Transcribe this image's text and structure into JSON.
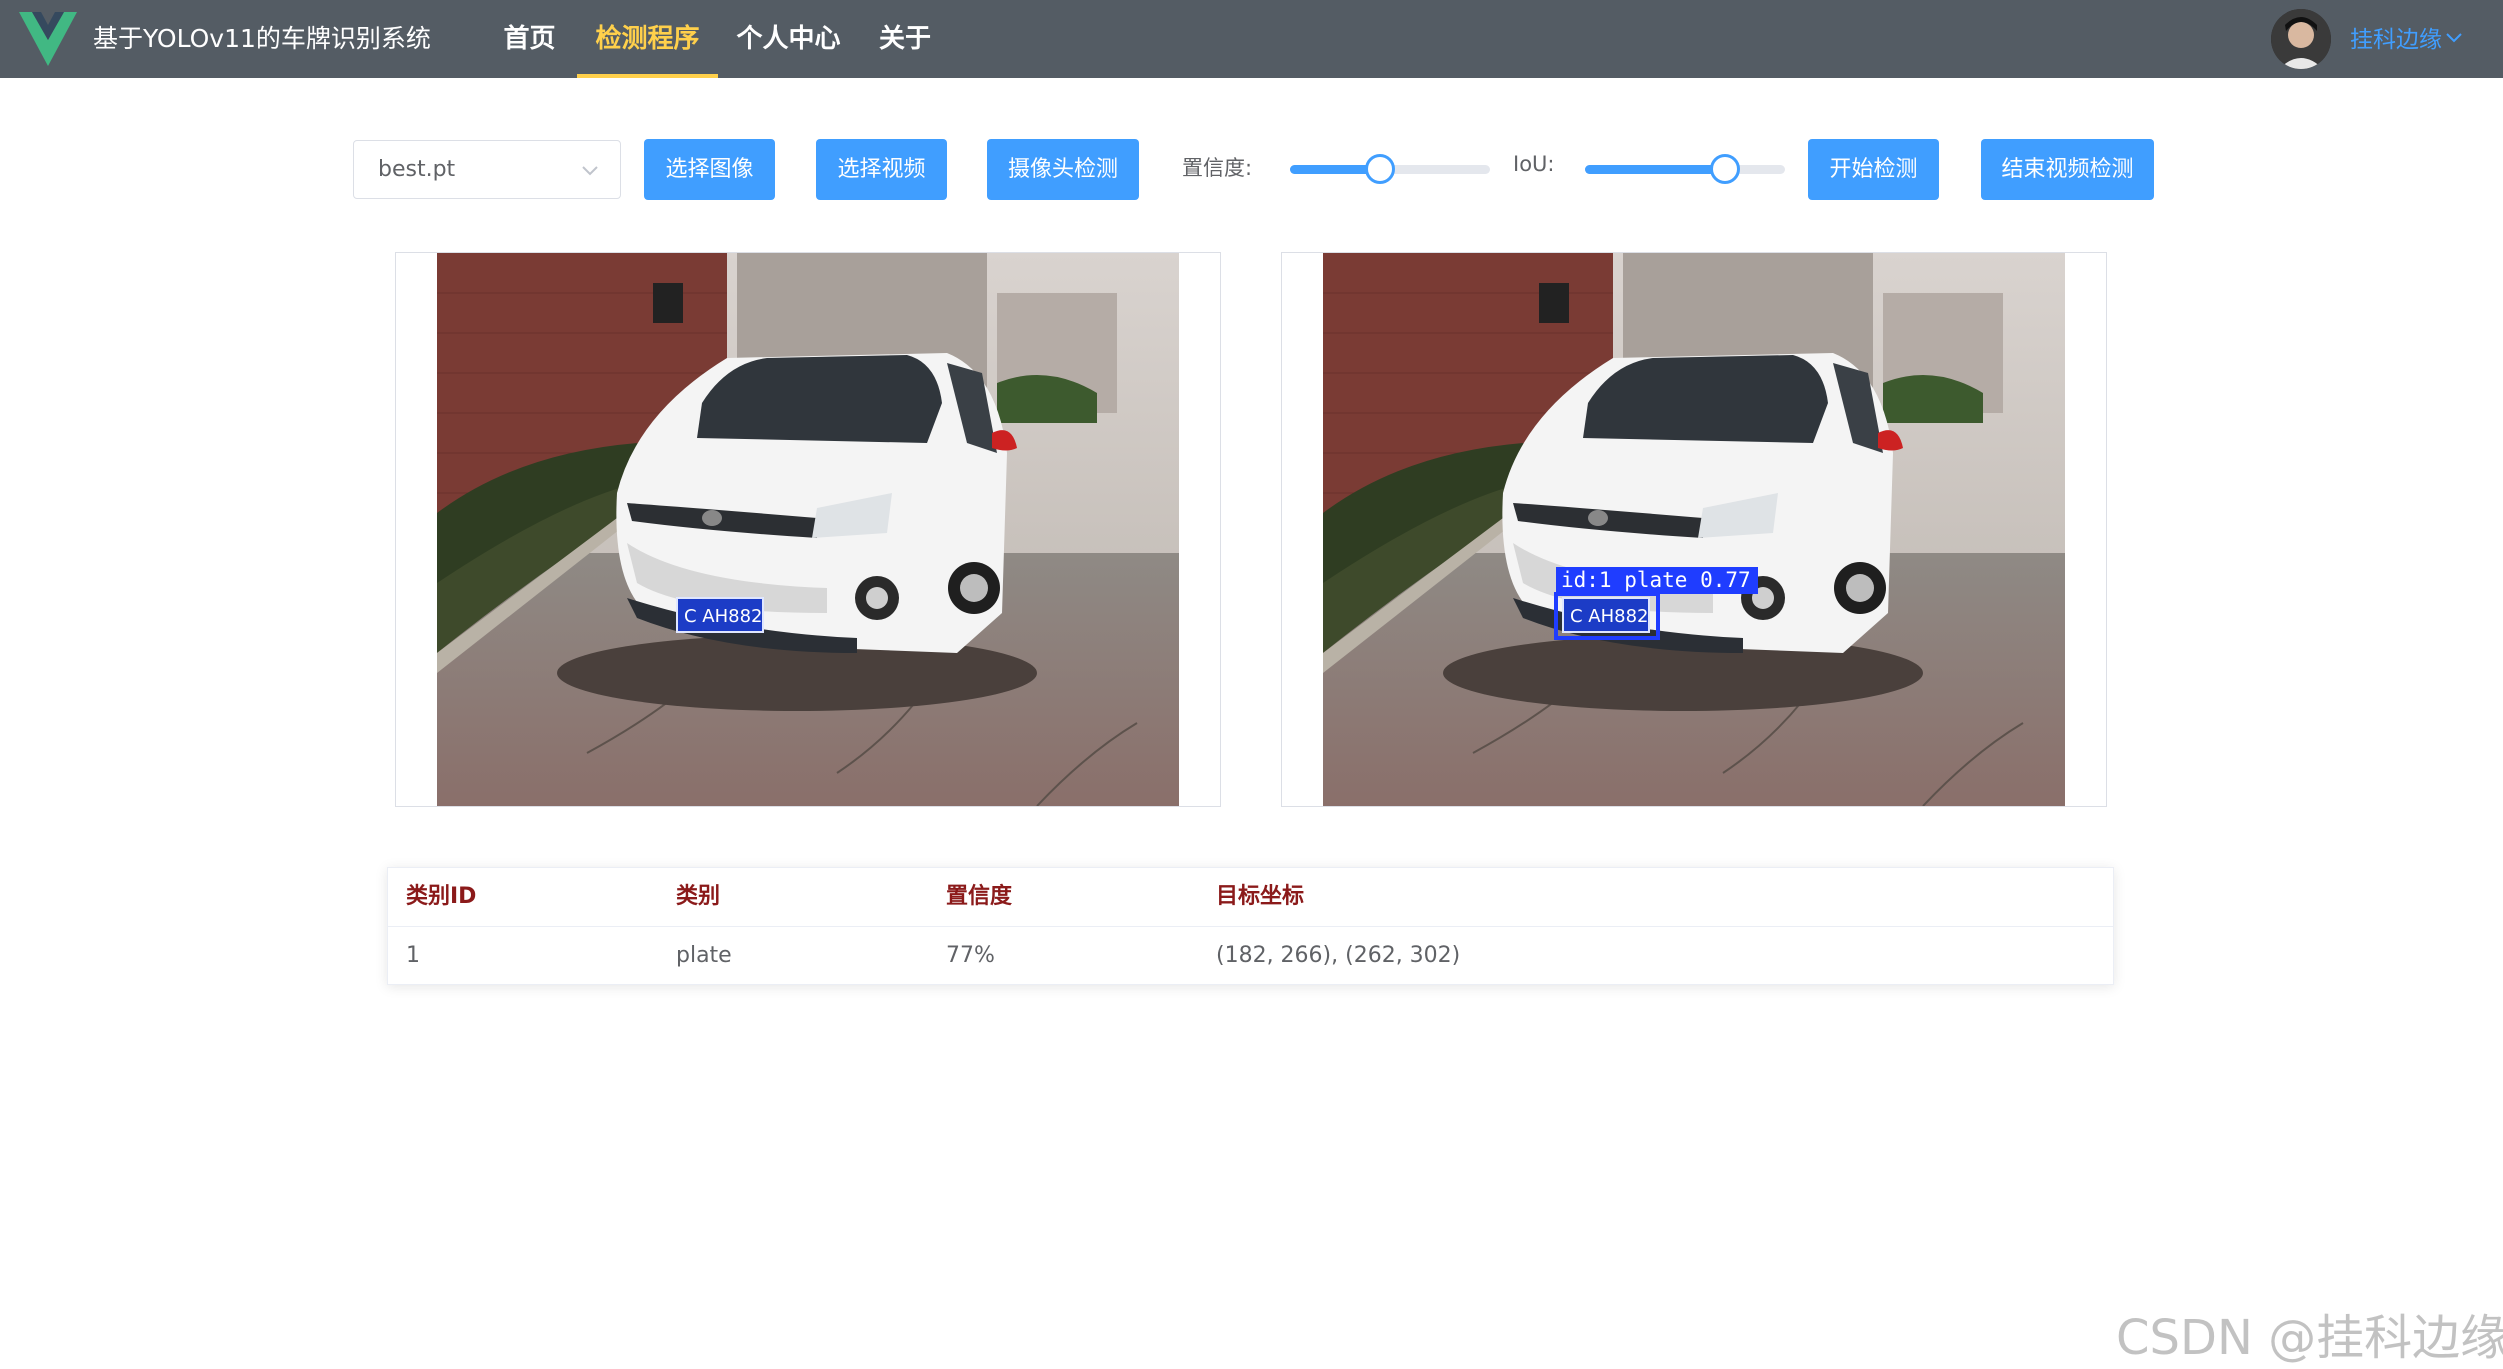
{
  "header": {
    "app_title": "基于YOLOv11的车牌识别系统",
    "nav": [
      {
        "label": "首页",
        "active": false
      },
      {
        "label": "检测程序",
        "active": true
      },
      {
        "label": "个人中心",
        "active": false
      },
      {
        "label": "关于",
        "active": false
      }
    ],
    "user_name": "挂科边缘",
    "active_color": "#ffd04b",
    "bar_color": "#545c64"
  },
  "toolbar": {
    "model_select": {
      "value": "best.pt"
    },
    "select_image_label": "选择图像",
    "select_video_label": "选择视频",
    "camera_detect_label": "摄像头检测",
    "confidence_label": "置信度:",
    "confidence_value": 0.45,
    "iou_label": "IoU:",
    "iou_value": 0.7,
    "start_detect_label": "开始检测",
    "stop_video_label": "结束视频检测",
    "accent_color": "#409eff"
  },
  "detection": {
    "overlay_label": "id:1 plate 0.77",
    "plate_text": "C AH882",
    "box_color": "#1f3dff"
  },
  "results_table": {
    "headers": [
      "类别ID",
      "类别",
      "置信度",
      "目标坐标"
    ],
    "rows": [
      [
        "1",
        "plate",
        "77%",
        "(182, 266), (262, 302)"
      ]
    ]
  },
  "watermark": "CSDN @挂科边缘"
}
